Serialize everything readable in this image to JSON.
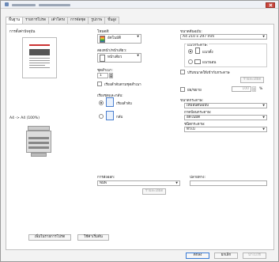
{
  "window": {
    "close_icon": "close-icon"
  },
  "tabs": [
    "พื้นฐาน",
    "รายการโปรด",
    "เค้าโครง",
    "การจัดชุด",
    "รูปภาพ",
    "ขั้นสูง"
  ],
  "left": {
    "heading": "การตั้งค่าปัจจุบัน",
    "preview_caption": "A4 -> A4 (100%)"
  },
  "color": {
    "label": "โหมดสี:",
    "value": "อัตโนมัติ"
  },
  "duplex": {
    "label": "สองหน้า/หน้าเดียว:",
    "value": "หน้าเดียว"
  },
  "copies": {
    "label": "ชุดสำเนา:",
    "value": "1"
  },
  "collate_label": "เรียงลำดับตามชุดสำเนา",
  "output": {
    "label": "เรียงชุดและกลับ:",
    "opt1": "เรียงลำดับ",
    "opt2": "กลับ"
  },
  "paper_size": {
    "label": "ขนาดต้นฉบับ:",
    "value": "A4 210 x 297 mm"
  },
  "orientation": {
    "label": "แนวกระดาษ:",
    "portrait": "แนวตั้ง",
    "landscape": "แนวนอน"
  },
  "fit": {
    "label": "ปรับขนาดให้เข้ากับกระดาษ",
    "detail_btn": "รายละเอียด"
  },
  "zoom": {
    "label": "ย่อ/ขยาย",
    "value": "100",
    "unit": "%"
  },
  "paper": {
    "label": "ขนาดกระดาษ:",
    "value": "เหมือนต้นฉบับ",
    "tray_label": "ถาดป้อนกระดาษ:",
    "tray_value": "อัตโนมัติ",
    "type_label": "ชนิดกระดาษ:",
    "type_value": "ทั่วไป"
  },
  "output_bin": {
    "label": "การส่งออก:",
    "value": "พิมพ์",
    "detail_btn": "รายละเอียด"
  },
  "comment": {
    "label": "ปลายทาง:",
    "value": ""
  },
  "bottom": {
    "add_fav": "เพิ่มในรายการโปรด",
    "defaults": "ใช้ค่าเริ่มต้น",
    "ok": "ตกลง",
    "cancel": "ยกเลิก",
    "apply": "นำไปใช้"
  },
  "colors": {
    "accent": "#3a7bd5",
    "close": "#c9463d"
  }
}
